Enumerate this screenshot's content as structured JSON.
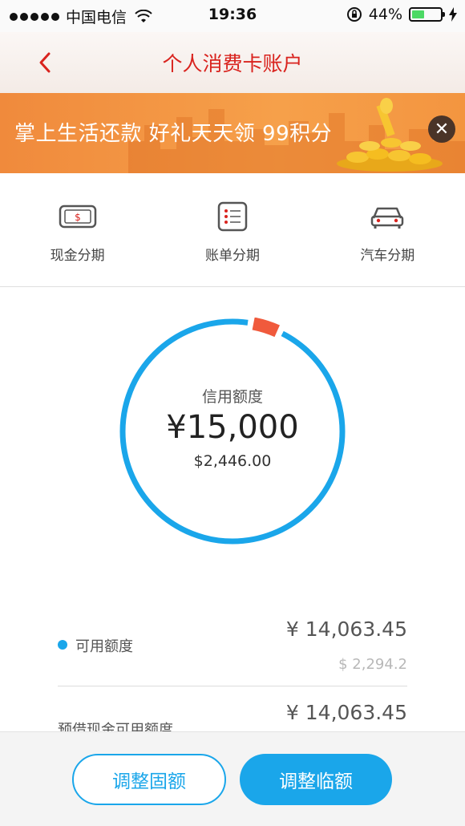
{
  "status_bar": {
    "carrier": "中国电信",
    "time": "19:36",
    "battery_percent": "44%",
    "battery_level": 0.44
  },
  "nav": {
    "back_icon": "chevron-left-icon",
    "title": "个人消费卡账户"
  },
  "banner": {
    "text": "掌上生活还款 好礼天天领 99积分",
    "close_symbol": "✕"
  },
  "quick_actions": [
    {
      "label": "现金分期",
      "icon": "cash-card-icon"
    },
    {
      "label": "账单分期",
      "icon": "bill-list-icon"
    },
    {
      "label": "汽车分期",
      "icon": "car-icon"
    }
  ],
  "credit": {
    "label": "信用额度",
    "amount": "¥15,000",
    "usd": "$2,446.00",
    "ring_color": "#1aa6ea",
    "used_marker_color": "#f05a3c"
  },
  "details": {
    "available_label": "可用额度",
    "available_amount": "¥ 14,063.45",
    "available_usd": "$ 2,294.2",
    "cash_label": "预借现金可用额度",
    "cash_amount": "¥ 14,063.45"
  },
  "actions": {
    "adjust_fixed": "调整固额",
    "adjust_temp": "调整临额"
  },
  "colors": {
    "accent_blue": "#1aa6ea",
    "title_red": "#d9231e",
    "banner_orange": "#f39540"
  }
}
